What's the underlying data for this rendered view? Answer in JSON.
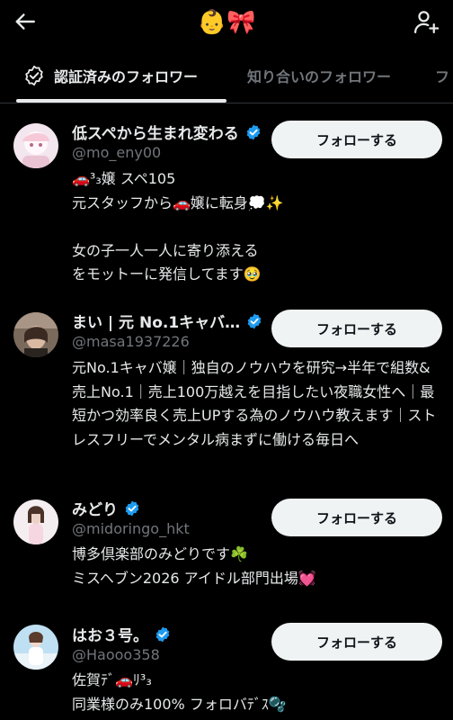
{
  "header": {
    "title": "👶🎀",
    "back_icon": "arrow-left-icon",
    "add_icon": "add-user-icon"
  },
  "tabs": [
    {
      "label": "認証済みのフォロワー",
      "active": true
    },
    {
      "label": "知り合いのフォロワー",
      "active": false
    },
    {
      "label": "フ",
      "active": false
    }
  ],
  "colors": {
    "background": "#000000",
    "text": "#e7e9ea",
    "muted": "#71767b",
    "verified": "#1d9bf0",
    "button_bg": "#eff3f4"
  },
  "users": [
    {
      "name": "低スペから生まれ変わる",
      "handle": "@mo_eny00",
      "button": "フォローする",
      "bio": "🚗³₃嬢 スペ105\n元スタッフから🚗嬢に転身💭✨\n\n女の子一人一人に寄り添える\nをモットーに発信してます🥹"
    },
    {
      "name": "まい | 元 No.1キャバ…",
      "handle": "@masa1937226",
      "button": "フォローする",
      "bio": "元No.1キャバ嬢｜独自のノウハウを研究→半年で組数&売上No.1｜売上100万越えを目指したい夜職女性へ｜最短かつ効率良く売上UPする為のノウハウ教えます｜ストレスフリーでメンタル病まずに働ける毎日へ"
    },
    {
      "name": "みどり",
      "handle": "@midoringo_hkt",
      "button": "フォローする",
      "bio": "博多倶楽部のみどりです☘️\nミスヘブン2026 アイドル部門出場💓"
    },
    {
      "name": "はお３号。",
      "handle": "@Haooo358",
      "button": "フォローする",
      "bio": "佐賀ﾃﾞ🚗ﾘ³₃\n同業様のみ100% フォロバﾃﾞｽ🫧"
    }
  ]
}
